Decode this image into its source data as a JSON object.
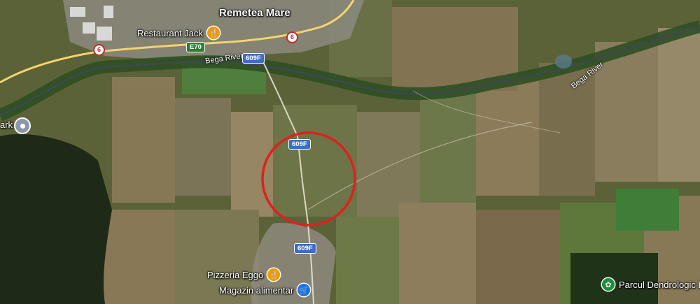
{
  "map": {
    "type": "satellite",
    "town": "Remetea Mare",
    "pois": [
      {
        "id": "restaurant",
        "label": "Restaurant Jack",
        "icon": "restaurant-icon",
        "color": "#f29900"
      },
      {
        "id": "pizzeria",
        "label": "Pizzeria Eggo",
        "icon": "restaurant-icon",
        "color": "#f29900"
      },
      {
        "id": "magazin",
        "label": "Magazin alimentar",
        "icon": "shopping-cart-icon",
        "color": "#1a73e8"
      },
      {
        "id": "parcul",
        "label": "Parcul Dendrologic B",
        "icon": "flower-icon",
        "color": "#1e8e3e"
      },
      {
        "id": "park-left",
        "label": "ark",
        "icon": "place-pin-icon",
        "color": "#8a97a6"
      }
    ],
    "rivers": [
      "Bega River",
      "Bega River"
    ],
    "roads": {
      "route6": "6",
      "e70": "E70",
      "r609f": "609F"
    },
    "highlight": {
      "shape": "circle",
      "color": "#e02020"
    }
  }
}
